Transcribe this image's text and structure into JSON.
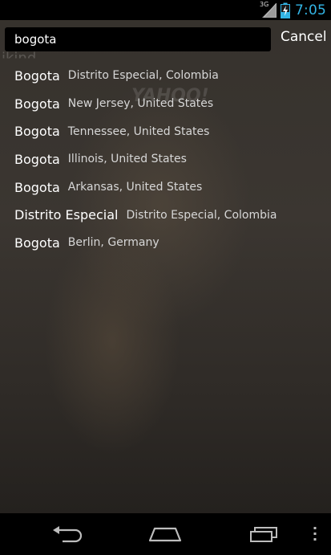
{
  "status_bar": {
    "network": "3G",
    "time": "7:05"
  },
  "background": {
    "ghost_word": "ikind",
    "watermark": "YAHOO!"
  },
  "search": {
    "value": "bogota",
    "cancel_label": "Cancel"
  },
  "results": [
    {
      "name": "Bogota",
      "region": "Distrito Especial, Colombia"
    },
    {
      "name": "Bogota",
      "region": "New Jersey, United States"
    },
    {
      "name": "Bogota",
      "region": "Tennessee, United States"
    },
    {
      "name": "Bogota",
      "region": "Illinois, United States"
    },
    {
      "name": "Bogota",
      "region": "Arkansas, United States"
    },
    {
      "name": "Distrito Especial",
      "region": "Distrito Especial, Colombia"
    },
    {
      "name": "Bogota",
      "region": "Berlin, Germany"
    }
  ],
  "navigation": {
    "icons": [
      "back-icon",
      "home-icon",
      "recent-apps-icon",
      "overflow-menu-icon"
    ]
  },
  "colors": {
    "time_accent": "#33b5e5",
    "status_bar_bg": "#000000",
    "search_field_bg": "#000000"
  }
}
